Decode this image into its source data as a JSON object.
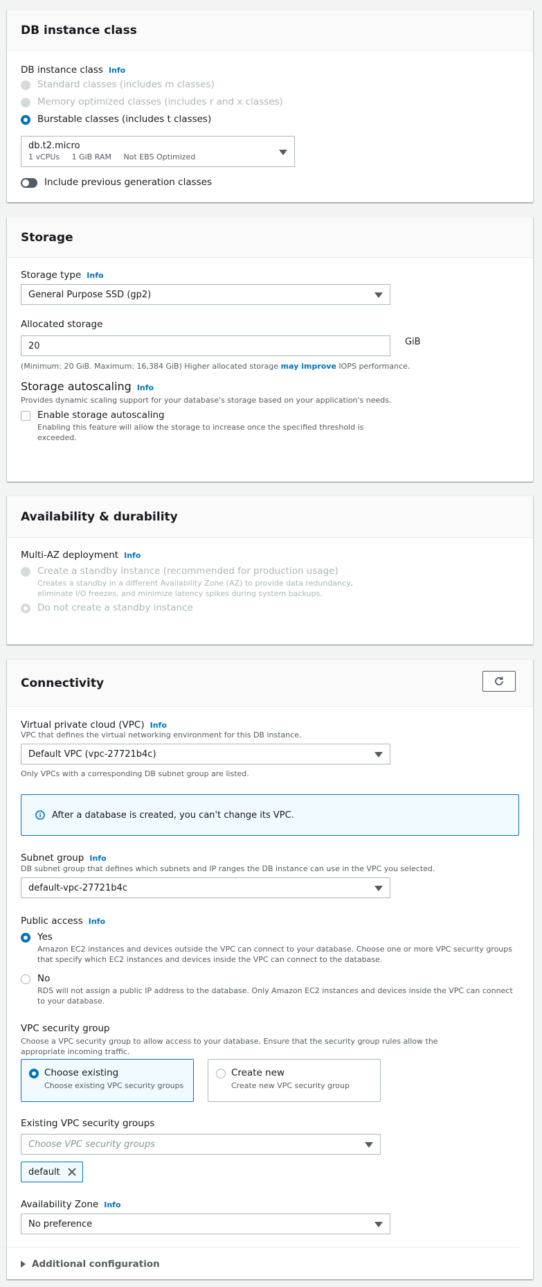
{
  "db_instance_class": {
    "title": "DB instance class",
    "field_label": "DB instance class",
    "info": "Info",
    "options": [
      {
        "label": "Standard classes (includes m classes)",
        "state": "disabled"
      },
      {
        "label": "Memory optimized classes (includes r and x classes)",
        "state": "disabled"
      },
      {
        "label": "Burstable classes (includes t classes)",
        "state": "selected"
      }
    ],
    "select": {
      "value": "db.t2.micro",
      "vcpus": "1 vCPUs",
      "ram": "1 GiB RAM",
      "ebs": "Not EBS Optimized"
    },
    "toggle_label": "Include previous generation classes",
    "toggle_on": false
  },
  "storage": {
    "title": "Storage",
    "type_label": "Storage type",
    "info": "Info",
    "type_value": "General Purpose SSD (gp2)",
    "allocated_label": "Allocated storage",
    "allocated_value": "20",
    "unit": "GiB",
    "hint_prefix": "(Minimum: 20 GiB. Maximum: 16,384 GiB) Higher allocated storage ",
    "hint_link": "may improve",
    "hint_suffix": " IOPS performance.",
    "autoscaling_title": "Storage autoscaling",
    "autoscaling_desc": "Provides dynamic scaling support for your database's storage based on your application's needs.",
    "autoscaling_checkbox_label": "Enable storage autoscaling",
    "autoscaling_checkbox_desc": "Enabling this feature will allow the storage to increase once the specified threshold is exceeded.",
    "autoscaling_checked": false
  },
  "availability": {
    "title": "Availability & durability",
    "field_label": "Multi-AZ deployment",
    "info": "Info",
    "options": [
      {
        "label": "Create a standby instance (recommended for production usage)",
        "desc": "Creates a standby in a different Availability Zone (AZ) to provide data redundancy, eliminate I/O freezes, and minimize latency spikes during system backups.",
        "state": "disabled"
      },
      {
        "label": "Do not create a standby instance",
        "desc": "",
        "state": "disabled-selected"
      }
    ]
  },
  "connectivity": {
    "title": "Connectivity",
    "refresh_icon": "refresh-icon",
    "vpc_label": "Virtual private cloud (VPC)",
    "info": "Info",
    "vpc_desc": "VPC that defines the virtual networking environment for this DB instance.",
    "vpc_value": "Default VPC (vpc-27721b4c)",
    "vpc_hint": "Only VPCs with a corresponding DB subnet group are listed.",
    "alert_text": "After a database is created, you can't change its VPC.",
    "subnet_label": "Subnet group",
    "subnet_desc": "DB subnet group that defines which subnets and IP ranges the DB instance can use in the VPC you selected.",
    "subnet_value": "default-vpc-27721b4c",
    "public_access_label": "Public access",
    "public_options": [
      {
        "label": "Yes",
        "desc": "Amazon EC2 instances and devices outside the VPC can connect to your database. Choose one or more VPC security groups that specify which EC2 instances and devices inside the VPC can connect to the database.",
        "selected": true
      },
      {
        "label": "No",
        "desc": "RDS will not assign a public IP address to the database. Only Amazon EC2 instances and devices inside the VPC can connect to your database.",
        "selected": false
      }
    ],
    "sg_label": "VPC security group",
    "sg_desc": "Choose a VPC security group to allow access to your database. Ensure that the security group rules allow the appropriate incoming traffic.",
    "sg_tiles": [
      {
        "label": "Choose existing",
        "desc": "Choose existing VPC security groups",
        "selected": true
      },
      {
        "label": "Create new",
        "desc": "Create new VPC security group",
        "selected": false
      }
    ],
    "existing_sg_label": "Existing VPC security groups",
    "existing_sg_placeholder": "Choose VPC security groups",
    "tokens": [
      "default"
    ],
    "az_label": "Availability Zone",
    "az_value": "No preference",
    "additional_config": "Additional configuration"
  },
  "colors": {
    "accent": "#0073bb",
    "info_bg": "#f1faff",
    "page_bg": "#f2f3f3"
  }
}
